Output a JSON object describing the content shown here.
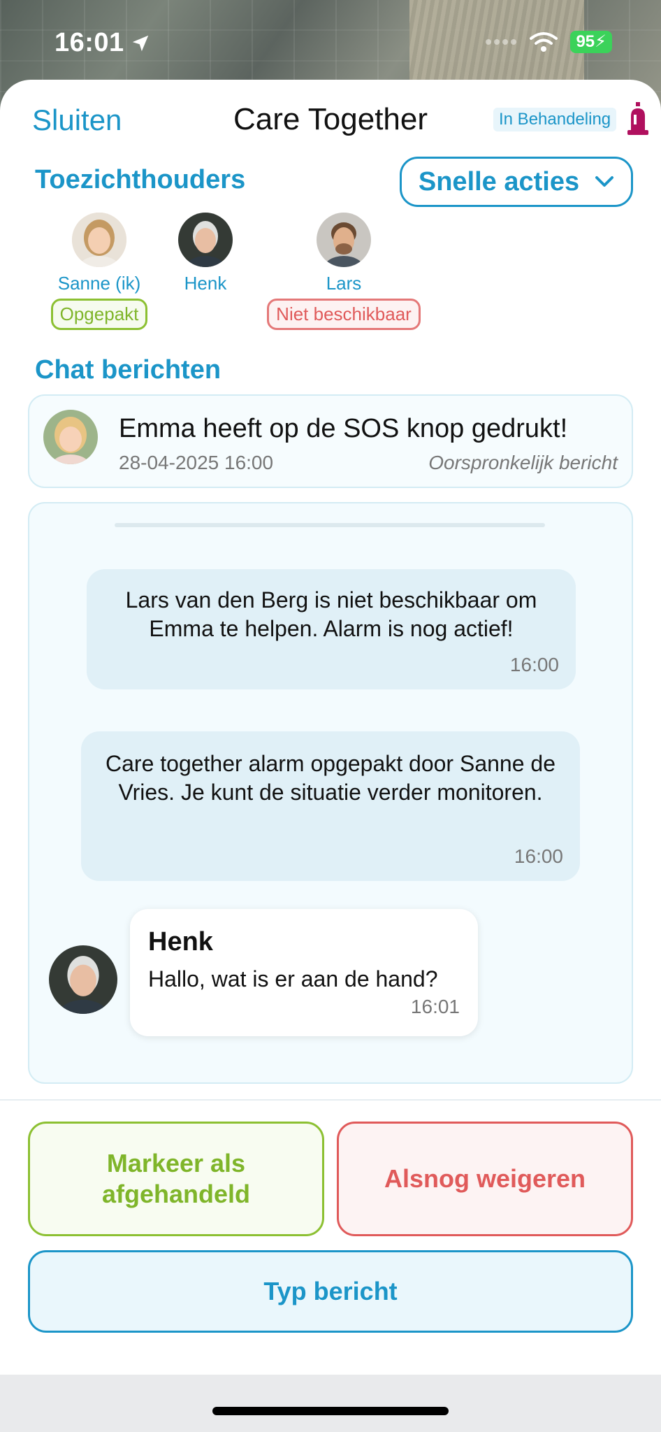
{
  "status_bar": {
    "time": "16:01",
    "battery": "95"
  },
  "header": {
    "close_label": "Sluiten",
    "title": "Care Together",
    "status": "In Behandeling"
  },
  "caretakers": {
    "title": "Toezichthouders",
    "quick_actions_label": "Snelle acties",
    "people": [
      {
        "name": "Sanne (ik)",
        "badge": "Opgepakt"
      },
      {
        "name": "Henk",
        "badge": ""
      },
      {
        "name": "Lars",
        "badge": "Niet beschikbaar"
      }
    ]
  },
  "chat": {
    "title": "Chat berichten",
    "original": {
      "text": "Emma heeft op de SOS knop gedrukt!",
      "date": "28-04-2025 16:00",
      "label": "Oorspronkelijk bericht"
    },
    "messages": [
      {
        "text": "Lars van den Berg is niet beschikbaar om Emma te helpen. Alarm is nog actief!",
        "time": "16:00"
      },
      {
        "text": "Care together alarm opgepakt door Sanne de Vries. Je kunt de situatie verder monitoren.",
        "time": "16:00"
      },
      {
        "sender": "Henk",
        "text": "Hallo, wat is er aan de hand?",
        "time": "16:01"
      }
    ]
  },
  "actions": {
    "mark_done": "Markeer als afgehandeld",
    "refuse": "Alsnog weigeren",
    "type_message": "Typ bericht"
  },
  "colors": {
    "accent": "#1b95c8",
    "success": "#7fb52a",
    "danger": "#e05a5a",
    "siren": "#b0105e"
  }
}
